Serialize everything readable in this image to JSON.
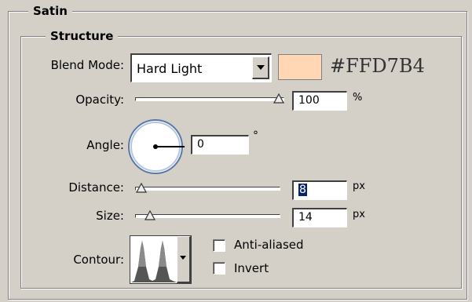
{
  "satin": {
    "title": "Satin"
  },
  "structure": {
    "title": "Structure"
  },
  "blend_mode": {
    "label": "Blend Mode:",
    "value": "Hard Light",
    "color": "#FFD7B4",
    "color_text": "#FFD7B4"
  },
  "opacity": {
    "label": "Opacity:",
    "value": "100",
    "unit": "%",
    "level": 1.0
  },
  "angle": {
    "label": "Angle:",
    "value": "0",
    "unit": "°"
  },
  "distance": {
    "label": "Distance:",
    "value": "8",
    "unit": "px",
    "level": 0.04
  },
  "size": {
    "label": "Size:",
    "value": "14",
    "unit": "px",
    "level": 0.07
  },
  "contour": {
    "label": "Contour:"
  },
  "anti_aliased": {
    "label": "Anti-aliased",
    "checked": false
  },
  "invert": {
    "label": "Invert",
    "checked": false
  }
}
